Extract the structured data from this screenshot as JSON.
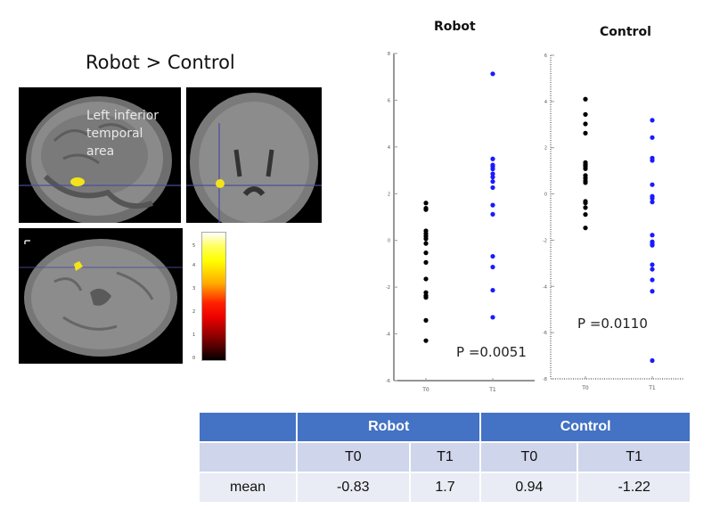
{
  "figure": {
    "title": "Robot > Control",
    "region_label": "Left inferior temporal area",
    "region_label_lines": [
      "Left inferior",
      "temporal",
      "area"
    ],
    "colorbar": {
      "ticks": [
        "0",
        "1",
        "2",
        "3",
        "4",
        "5"
      ],
      "colormap": "hot"
    },
    "views": [
      "sagittal",
      "coronal",
      "axial"
    ]
  },
  "chart_data": [
    {
      "type": "scatter",
      "title": "Robot",
      "categories": [
        "T0",
        "T1"
      ],
      "ylim": [
        -6,
        8
      ],
      "yticks": [
        "8",
        "6",
        "4",
        "2",
        "0",
        "-2",
        "-4",
        "-6"
      ],
      "annotation": "P =0.0051",
      "series": [
        {
          "name": "T0",
          "color": "#000000",
          "values": [
            1.6,
            1.38,
            1.32,
            0.41,
            0.29,
            0.18,
            0.07,
            -0.13,
            -0.53,
            -0.94,
            -1.65,
            -2.23,
            -2.36,
            -2.44,
            -3.42,
            -4.29
          ]
        },
        {
          "name": "T1",
          "color": "#1a1aff",
          "values": [
            7.13,
            3.49,
            3.23,
            3.17,
            3.06,
            2.85,
            2.71,
            2.52,
            2.26,
            1.51,
            1.12,
            -0.68,
            -1.14,
            -2.13,
            -3.29
          ]
        }
      ],
      "axis_style": "solid"
    },
    {
      "type": "scatter",
      "title": "Control",
      "categories": [
        "T0",
        "T1"
      ],
      "ylim": [
        -8,
        6
      ],
      "yticks": [
        "6",
        "4",
        "2",
        "0",
        "-2",
        "-4",
        "-6",
        "-8"
      ],
      "annotation": "P =0.0110",
      "series": [
        {
          "name": "T0",
          "color": "#000000",
          "values": [
            4.1,
            3.44,
            3.03,
            2.63,
            1.36,
            1.27,
            1.19,
            1.09,
            0.8,
            0.69,
            0.58,
            0.49,
            -0.32,
            -0.39,
            -0.59,
            -0.89,
            -1.47
          ]
        },
        {
          "name": "T1",
          "color": "#1a1aff",
          "values": [
            3.19,
            2.44,
            1.55,
            1.45,
            0.4,
            -0.1,
            -0.19,
            -0.35,
            -1.78,
            -2.07,
            -2.16,
            -2.22,
            -3.06,
            -3.26,
            -3.72,
            -4.21,
            -7.21
          ]
        }
      ],
      "axis_style": "dotted"
    }
  ],
  "table": {
    "groups": [
      "Robot",
      "Control"
    ],
    "subheaders": [
      "T0",
      "T1",
      "T0",
      "T1"
    ],
    "rows": [
      {
        "label": "mean",
        "values": [
          "-0.83",
          "1.7",
          "0.94",
          "-1.22"
        ]
      }
    ]
  }
}
